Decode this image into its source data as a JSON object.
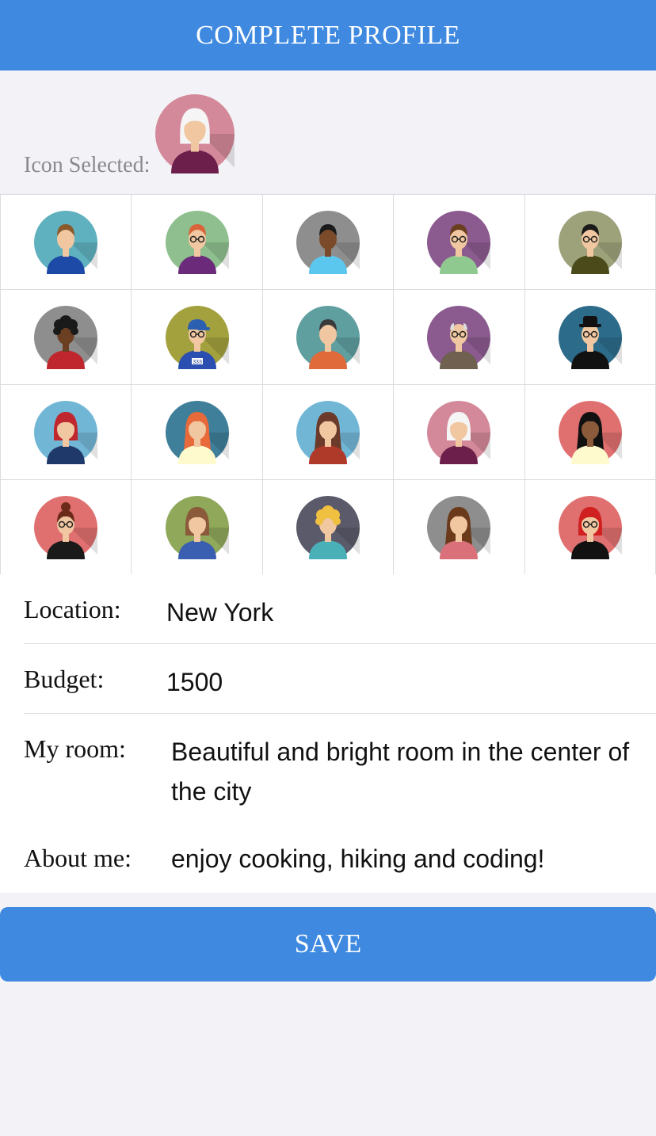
{
  "header": {
    "title": "COMPLETE PROFILE"
  },
  "selected": {
    "label": "Icon Selected:",
    "avatar": {
      "bg": "#d4899a",
      "skin": "#f0c7a0",
      "hair": "#f5f5f5",
      "shirt": "#6b1f4a",
      "accent": "#e0509c",
      "style": "bob"
    }
  },
  "avatars": [
    {
      "name": "avatar-man-blue",
      "bg": "#5fb1bf",
      "skin": "#f0c7a0",
      "hair": "#8a5a2b",
      "shirt": "#1c4aa6",
      "style": "short"
    },
    {
      "name": "avatar-man-glasses-purple",
      "bg": "#8fbf8f",
      "skin": "#f0c7a0",
      "hair": "#d9643a",
      "shirt": "#6b2a7a",
      "style": "short",
      "glasses": true
    },
    {
      "name": "avatar-man-dark-skin",
      "bg": "#8e8e8e",
      "skin": "#7a4a2a",
      "hair": "#1a1a1a",
      "shirt": "#5bc7ef",
      "style": "short"
    },
    {
      "name": "avatar-man-glasses-green",
      "bg": "#8b5a8f",
      "skin": "#f0c7a0",
      "hair": "#6a3f1f",
      "shirt": "#8fc98f",
      "style": "short",
      "glasses": true
    },
    {
      "name": "avatar-man-mustache",
      "bg": "#9ea27a",
      "skin": "#f0c7a0",
      "hair": "#1a1a1a",
      "shirt": "#4a4a1a",
      "style": "short",
      "glasses": true
    },
    {
      "name": "avatar-man-beard-striped",
      "bg": "#8e8e8e",
      "skin": "#6b3f22",
      "hair": "#1a1a1a",
      "shirt": "#c0262d",
      "style": "curly"
    },
    {
      "name": "avatar-boy-cap-333",
      "bg": "#a3a03e",
      "skin": "#f0c7a0",
      "hair": "#2b5fb0",
      "shirt": "#2b4fb0",
      "style": "cap",
      "glasses": true,
      "badge": "333"
    },
    {
      "name": "avatar-man-beard",
      "bg": "#5f9fa0",
      "skin": "#f0c7a0",
      "hair": "#3a3a3a",
      "shirt": "#e06a3a",
      "style": "short"
    },
    {
      "name": "avatar-old-man",
      "bg": "#8b5a8f",
      "skin": "#f0c7a0",
      "hair": "#dcdcdc",
      "shirt": "#6f6050",
      "style": "bald",
      "glasses": true
    },
    {
      "name": "avatar-man-hat",
      "bg": "#2d6b8a",
      "skin": "#f0c7a0",
      "hair": "#1a1a1a",
      "shirt": "#111111",
      "style": "hat",
      "glasses": true
    },
    {
      "name": "avatar-woman-red-hair",
      "bg": "#72b6d6",
      "skin": "#f0c7a0",
      "hair": "#c0262d",
      "shirt": "#1f3a6a",
      "style": "bob"
    },
    {
      "name": "avatar-woman-orange-hair",
      "bg": "#3f7f9a",
      "skin": "#f0c7a0",
      "hair": "#e86a3a",
      "shirt": "#fffacd",
      "style": "long"
    },
    {
      "name": "avatar-woman-long-brown",
      "bg": "#72b6d6",
      "skin": "#f0c7a0",
      "hair": "#6b3a2a",
      "shirt": "#b03a2a",
      "style": "long"
    },
    {
      "name": "avatar-woman-white-hair",
      "bg": "#d4899a",
      "skin": "#f0c7a0",
      "hair": "#f5f5f5",
      "shirt": "#6b1f4a",
      "style": "bob"
    },
    {
      "name": "avatar-woman-dark-skin",
      "bg": "#e07070",
      "skin": "#8a5a3a",
      "hair": "#111111",
      "shirt": "#fffacd",
      "style": "long"
    },
    {
      "name": "avatar-woman-bun-glasses",
      "bg": "#e07070",
      "skin": "#f0c7a0",
      "hair": "#6b2a1a",
      "shirt": "#1a1a1a",
      "style": "bun",
      "glasses": true
    },
    {
      "name": "avatar-woman-brown-bob",
      "bg": "#8fa85a",
      "skin": "#f0c7a0",
      "hair": "#8a5a3a",
      "shirt": "#3a5fb0",
      "style": "bob"
    },
    {
      "name": "avatar-woman-curly-blonde",
      "bg": "#5a5a6a",
      "skin": "#f0c7a0",
      "hair": "#f0c040",
      "shirt": "#4ab0b8",
      "style": "curly"
    },
    {
      "name": "avatar-woman-ponytail",
      "bg": "#8e8e8e",
      "skin": "#f0c7a0",
      "hair": "#6b3a1a",
      "shirt": "#d9707a",
      "style": "long"
    },
    {
      "name": "avatar-woman-red-sunglasses",
      "bg": "#e07070",
      "skin": "#f0c7a0",
      "hair": "#d02020",
      "shirt": "#111111",
      "style": "bob",
      "glasses": true
    }
  ],
  "form": {
    "location": {
      "label": "Location:",
      "value": "New York"
    },
    "budget": {
      "label": "Budget:",
      "value": "1500"
    },
    "room": {
      "label": "My room:",
      "value": "Beautiful and bright room in the center of the city"
    },
    "about": {
      "label": "About me:",
      "value": "enjoy cooking, hiking and coding!"
    }
  },
  "save": {
    "label": "SAVE"
  },
  "colors": {
    "accent": "#3f8ae0",
    "background": "#f3f3f7"
  }
}
